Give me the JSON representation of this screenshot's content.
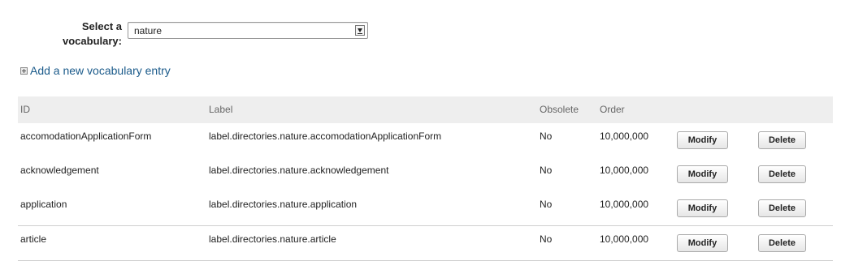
{
  "vocab_select": {
    "label": "Select a\nvocabulary:",
    "selected_value": "nature"
  },
  "add_entry": {
    "label": "Add a new vocabulary entry"
  },
  "table": {
    "headers": {
      "id": "ID",
      "label": "Label",
      "obsolete": "Obsolete",
      "order": "Order"
    },
    "rows": [
      {
        "id": "accomodationApplicationForm",
        "label": "label.directories.nature.accomodationApplicationForm",
        "obsolete": "No",
        "order": "10,000,000",
        "modify": "Modify",
        "delete": "Delete"
      },
      {
        "id": "acknowledgement",
        "label": "label.directories.nature.acknowledgement",
        "obsolete": "No",
        "order": "10,000,000",
        "modify": "Modify",
        "delete": "Delete"
      },
      {
        "id": "application",
        "label": "label.directories.nature.application",
        "obsolete": "No",
        "order": "10,000,000",
        "modify": "Modify",
        "delete": "Delete"
      },
      {
        "id": "article",
        "label": "label.directories.nature.article",
        "obsolete": "No",
        "order": "10,000,000",
        "modify": "Modify",
        "delete": "Delete"
      }
    ]
  },
  "colors": {
    "link": "#1a5a8a",
    "header_bg": "#eeeeee",
    "divider": "#cfcfcf"
  },
  "icons": {
    "add": "plus-box-icon",
    "dropdown": "chevron-down-icon"
  }
}
